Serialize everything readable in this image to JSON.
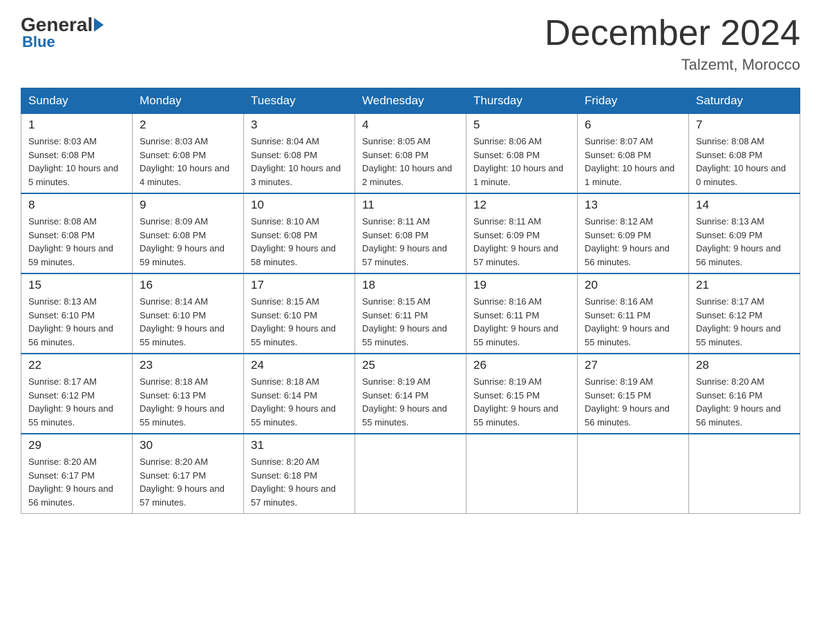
{
  "header": {
    "logo_general": "General",
    "logo_blue": "Blue",
    "month_title": "December 2024",
    "location": "Talzemt, Morocco"
  },
  "weekdays": [
    "Sunday",
    "Monday",
    "Tuesday",
    "Wednesday",
    "Thursday",
    "Friday",
    "Saturday"
  ],
  "weeks": [
    [
      {
        "day": "1",
        "sunrise": "8:03 AM",
        "sunset": "6:08 PM",
        "daylight": "10 hours and 5 minutes."
      },
      {
        "day": "2",
        "sunrise": "8:03 AM",
        "sunset": "6:08 PM",
        "daylight": "10 hours and 4 minutes."
      },
      {
        "day": "3",
        "sunrise": "8:04 AM",
        "sunset": "6:08 PM",
        "daylight": "10 hours and 3 minutes."
      },
      {
        "day": "4",
        "sunrise": "8:05 AM",
        "sunset": "6:08 PM",
        "daylight": "10 hours and 2 minutes."
      },
      {
        "day": "5",
        "sunrise": "8:06 AM",
        "sunset": "6:08 PM",
        "daylight": "10 hours and 1 minute."
      },
      {
        "day": "6",
        "sunrise": "8:07 AM",
        "sunset": "6:08 PM",
        "daylight": "10 hours and 1 minute."
      },
      {
        "day": "7",
        "sunrise": "8:08 AM",
        "sunset": "6:08 PM",
        "daylight": "10 hours and 0 minutes."
      }
    ],
    [
      {
        "day": "8",
        "sunrise": "8:08 AM",
        "sunset": "6:08 PM",
        "daylight": "9 hours and 59 minutes."
      },
      {
        "day": "9",
        "sunrise": "8:09 AM",
        "sunset": "6:08 PM",
        "daylight": "9 hours and 59 minutes."
      },
      {
        "day": "10",
        "sunrise": "8:10 AM",
        "sunset": "6:08 PM",
        "daylight": "9 hours and 58 minutes."
      },
      {
        "day": "11",
        "sunrise": "8:11 AM",
        "sunset": "6:08 PM",
        "daylight": "9 hours and 57 minutes."
      },
      {
        "day": "12",
        "sunrise": "8:11 AM",
        "sunset": "6:09 PM",
        "daylight": "9 hours and 57 minutes."
      },
      {
        "day": "13",
        "sunrise": "8:12 AM",
        "sunset": "6:09 PM",
        "daylight": "9 hours and 56 minutes."
      },
      {
        "day": "14",
        "sunrise": "8:13 AM",
        "sunset": "6:09 PM",
        "daylight": "9 hours and 56 minutes."
      }
    ],
    [
      {
        "day": "15",
        "sunrise": "8:13 AM",
        "sunset": "6:10 PM",
        "daylight": "9 hours and 56 minutes."
      },
      {
        "day": "16",
        "sunrise": "8:14 AM",
        "sunset": "6:10 PM",
        "daylight": "9 hours and 55 minutes."
      },
      {
        "day": "17",
        "sunrise": "8:15 AM",
        "sunset": "6:10 PM",
        "daylight": "9 hours and 55 minutes."
      },
      {
        "day": "18",
        "sunrise": "8:15 AM",
        "sunset": "6:11 PM",
        "daylight": "9 hours and 55 minutes."
      },
      {
        "day": "19",
        "sunrise": "8:16 AM",
        "sunset": "6:11 PM",
        "daylight": "9 hours and 55 minutes."
      },
      {
        "day": "20",
        "sunrise": "8:16 AM",
        "sunset": "6:11 PM",
        "daylight": "9 hours and 55 minutes."
      },
      {
        "day": "21",
        "sunrise": "8:17 AM",
        "sunset": "6:12 PM",
        "daylight": "9 hours and 55 minutes."
      }
    ],
    [
      {
        "day": "22",
        "sunrise": "8:17 AM",
        "sunset": "6:12 PM",
        "daylight": "9 hours and 55 minutes."
      },
      {
        "day": "23",
        "sunrise": "8:18 AM",
        "sunset": "6:13 PM",
        "daylight": "9 hours and 55 minutes."
      },
      {
        "day": "24",
        "sunrise": "8:18 AM",
        "sunset": "6:14 PM",
        "daylight": "9 hours and 55 minutes."
      },
      {
        "day": "25",
        "sunrise": "8:19 AM",
        "sunset": "6:14 PM",
        "daylight": "9 hours and 55 minutes."
      },
      {
        "day": "26",
        "sunrise": "8:19 AM",
        "sunset": "6:15 PM",
        "daylight": "9 hours and 55 minutes."
      },
      {
        "day": "27",
        "sunrise": "8:19 AM",
        "sunset": "6:15 PM",
        "daylight": "9 hours and 56 minutes."
      },
      {
        "day": "28",
        "sunrise": "8:20 AM",
        "sunset": "6:16 PM",
        "daylight": "9 hours and 56 minutes."
      }
    ],
    [
      {
        "day": "29",
        "sunrise": "8:20 AM",
        "sunset": "6:17 PM",
        "daylight": "9 hours and 56 minutes."
      },
      {
        "day": "30",
        "sunrise": "8:20 AM",
        "sunset": "6:17 PM",
        "daylight": "9 hours and 57 minutes."
      },
      {
        "day": "31",
        "sunrise": "8:20 AM",
        "sunset": "6:18 PM",
        "daylight": "9 hours and 57 minutes."
      },
      null,
      null,
      null,
      null
    ]
  ],
  "labels": {
    "sunrise": "Sunrise:",
    "sunset": "Sunset:",
    "daylight": "Daylight:"
  }
}
